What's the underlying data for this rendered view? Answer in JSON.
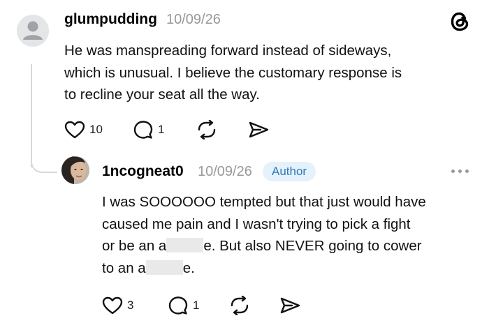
{
  "post": {
    "username": "glumpudding",
    "date": "10/09/26",
    "lines": [
      "He was manspreading forward instead of sideways,",
      "which is unusual.  I believe the customary response is",
      "to recline your seat all the way."
    ],
    "likes": "10",
    "replies": "1"
  },
  "reply": {
    "username": "1ncogneat0",
    "date": "10/09/26",
    "badge": "Author",
    "lines": [
      "I was SOOOOOO tempted but that just would have",
      "caused me pain and I wasn't trying to pick a fight"
    ],
    "line3_before": "or be an a",
    "line3_after": "e. But also NEVER going to cower",
    "line4_before": "to an a",
    "line4_after": "e.",
    "likes": "3",
    "replies": "1"
  },
  "icons": {
    "app_logo": "threads-logo-icon",
    "like": "heart-icon",
    "reply": "comment-icon",
    "repost": "repost-icon",
    "share": "send-icon",
    "more": "more-dots-icon"
  },
  "colors": {
    "badge_bg": "#e5f1fb",
    "badge_text": "#2a7ab8",
    "muted": "#999999",
    "thread_line": "#d8d8d8"
  }
}
